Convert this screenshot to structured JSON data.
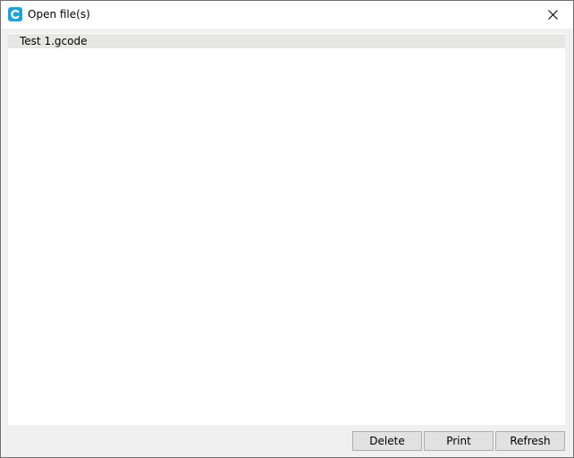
{
  "window": {
    "title": "Open file(s)",
    "app_icon": "creality-c-icon",
    "close_icon": "close-icon"
  },
  "file_list": {
    "items": [
      {
        "label": "Test 1.gcode",
        "selected": true
      }
    ]
  },
  "buttons": {
    "delete_label": "Delete",
    "print_label": "Print",
    "refresh_label": "Refresh"
  },
  "colors": {
    "app_icon": "#1ea3dc",
    "selected_row": "#e6e6e3",
    "button_face": "#e1e1e1",
    "button_border": "#adadad"
  }
}
